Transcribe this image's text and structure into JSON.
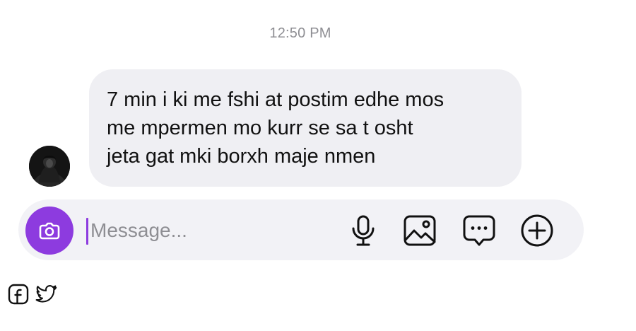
{
  "thread": {
    "timestamp": "12:50 PM",
    "messages": [
      {
        "sender": "other",
        "text": "7 min i ki me fshi at postim edhe mos\nme mpermen mo kurr se sa t osht\njeta gat mki borxh maje nmen"
      }
    ]
  },
  "composer": {
    "placeholder": "Message...",
    "value": "",
    "icons": {
      "camera": "camera-icon",
      "mic": "microphone-icon",
      "gallery": "image-icon",
      "sticker": "chat-bubble-icon",
      "more": "plus-circle-icon"
    }
  },
  "footer": {
    "icons": [
      "facebook-icon",
      "twitter-icon"
    ]
  },
  "colors": {
    "accent": "#8d3bdf",
    "bubble": "#efeff3",
    "composer": "#f2f2f6",
    "timestamp": "#8e8e93"
  }
}
